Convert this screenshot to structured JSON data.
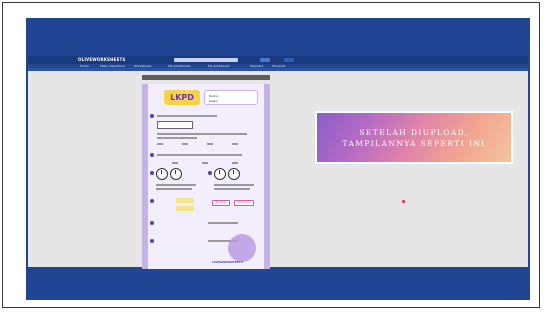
{
  "app": {
    "title": "OLIVEWORKSHEETS",
    "menu_items": [
      "Home",
      "Make interactive",
      "Worksheets",
      "My worksheets",
      "My workbooks",
      "Teachers",
      "Students"
    ]
  },
  "worksheet": {
    "title": "LKPD",
    "name_label": "Nama :",
    "class_label": "Kelas :",
    "button_1": "Pecahan",
    "button_2": "Pembilang",
    "footer": "LIVEWORKSHEETS"
  },
  "banner": {
    "line1": "SETELAH DIUPLOAD,",
    "line2": "TAMPILANNYA SEPERTI INI"
  },
  "colors": {
    "slide_bg": "#1f4593",
    "banner_start": "#8a5ec9",
    "banner_end": "#f6c3a0",
    "laser": "#e8253a"
  }
}
